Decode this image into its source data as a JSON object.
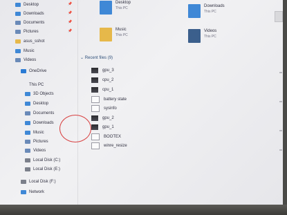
{
  "quick_access": [
    {
      "label": "Desktop",
      "pinned": true,
      "color": "#3f88d6"
    },
    {
      "label": "Downloads",
      "pinned": true,
      "color": "#3f88d6"
    },
    {
      "label": "Documents",
      "pinned": true,
      "color": "#6a8ab8"
    },
    {
      "label": "Pictures",
      "pinned": true,
      "color": "#6a8ab8"
    },
    {
      "label": "asus_sshot",
      "pinned": false,
      "color": "#e6b84a"
    },
    {
      "label": "Music",
      "pinned": false,
      "color": "#3f88d6"
    },
    {
      "label": "Videos",
      "pinned": false,
      "color": "#6a8ab8"
    }
  ],
  "onedrive": {
    "label": "OneDrive",
    "color": "#2a7bd4"
  },
  "this_pc": {
    "label": "This PC",
    "items": [
      {
        "label": "3D Objects",
        "color": "#3f88d6"
      },
      {
        "label": "Desktop",
        "color": "#3f88d6"
      },
      {
        "label": "Documents",
        "color": "#6a8ab8"
      },
      {
        "label": "Downloads",
        "color": "#3f88d6"
      },
      {
        "label": "Music",
        "color": "#3f88d6"
      },
      {
        "label": "Pictures",
        "color": "#6a8ab8"
      },
      {
        "label": "Videos",
        "color": "#6a8ab8"
      },
      {
        "label": "Local Disk (C:)",
        "color": "#7b7f8a"
      },
      {
        "label": "Local Disk (E:)",
        "color": "#7b7f8a"
      }
    ]
  },
  "local_disk_f": {
    "label": "Local Disk (F:)",
    "color": "#7b7f8a"
  },
  "network": {
    "label": "Network",
    "color": "#3f88d6"
  },
  "folders": [
    {
      "name": "Desktop",
      "location": "This PC",
      "color": "#3f88d6"
    },
    {
      "name": "Downloads",
      "location": "This PC",
      "color": "#3f88d6"
    },
    {
      "name": "Music",
      "location": "This PC",
      "color": "#e6b84a"
    },
    {
      "name": "Videos",
      "location": "This PC",
      "color": "#3b5f8c"
    }
  ],
  "recent_header": "Recent files (9)",
  "recent_files": [
    {
      "name": "gpu_3",
      "thumb": "dark"
    },
    {
      "name": "cpu_2",
      "thumb": "dark"
    },
    {
      "name": "cpu_1",
      "thumb": "dark"
    },
    {
      "name": "battery state",
      "thumb": "doc"
    },
    {
      "name": "sysinfo",
      "thumb": "doc"
    },
    {
      "name": "gpu_2",
      "thumb": "dark"
    },
    {
      "name": "gpu_1",
      "thumb": "dark"
    },
    {
      "name": "BOOTEX",
      "thumb": "doc"
    },
    {
      "name": "winre_resize",
      "thumb": "doc"
    }
  ],
  "colors": {
    "accent": "#30507a",
    "annotation": "#d84040"
  }
}
